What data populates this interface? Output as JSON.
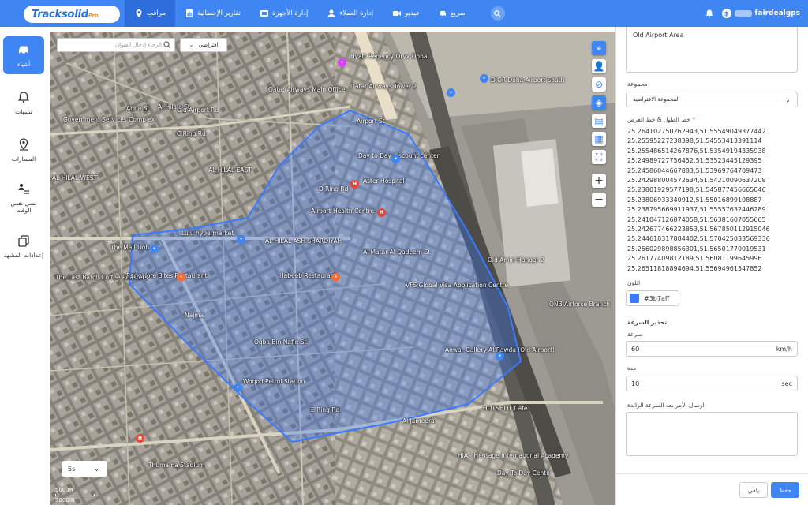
{
  "brand": {
    "logo": "Tracksolid",
    "logo_suffix": "Pro"
  },
  "nav": [
    {
      "label": "مراقب",
      "icon": "location-pin-icon",
      "active": true
    },
    {
      "label": "تقارير الإحصائية",
      "icon": "report-icon",
      "active": false
    },
    {
      "label": "إدارة الأجهزة",
      "icon": "device-icon",
      "active": false
    },
    {
      "label": "إدارة العملاء",
      "icon": "user-icon",
      "active": false
    },
    {
      "label": "فيديو",
      "icon": "video-icon",
      "active": false
    },
    {
      "label": "سريع",
      "icon": "car-icon",
      "active": false
    }
  ],
  "user": {
    "name": "fairdealgps"
  },
  "sidebar": [
    {
      "label": "أشياء",
      "icon": "car-icon",
      "active": true
    },
    {
      "label": "تنبيهات",
      "icon": "alert-icon",
      "active": false
    },
    {
      "label": "المسارات",
      "icon": "route-pin-icon",
      "active": false
    },
    {
      "label": "تسي نفس الوقت",
      "icon": "sync-icon",
      "active": false
    },
    {
      "label": "إعدادات المشهد",
      "icon": "copy-icon",
      "active": false
    }
  ],
  "map": {
    "search_placeholder": "الرجاء إدخال العنوان",
    "layer_select": "افتراضي",
    "interval": "5s",
    "scale_m": "500 m",
    "scale_ft": "3000 ft",
    "fence_color": "#3b7aff",
    "labels": [
      "AL HILAL EAST",
      "AL HILAL ASH SHARQIYAH",
      "AL HILAL WEST",
      "Lulu hypermarket",
      "The Mall Doha",
      "Bangalore Bites Restaurant",
      "Habeeb Restaurant",
      "Aster Hospital",
      "Airport Health Centre",
      "Day to Day discount center",
      "Qatar Airways Tower 2",
      "Qatar Airways Main Office",
      "Hyatt Regency Oryx Doha",
      "DIOR Doha Airport South",
      "Old Airport Rd",
      "Airport St",
      "C Ring Rd",
      "D Ring Rd",
      "E Ring Rd",
      "Government Services Complex",
      "Al Matar Al Qadeem St",
      "VFS Global Visa Application Centre",
      "Anwar Gallery Al Rawda (Old Airport)",
      "Woqod Petrol Station",
      "Oqba Bin Nafie St",
      "Najma",
      "Old Amiri Hangar 2",
      "QNB Airforce Branch",
      "Thumama Stadium",
      "HOTSHOT Café",
      "Al Jameera",
      "HIA - Heritage International Academy",
      "Day To Day Center",
      "The Last Batch Coffee Roasters",
      "Abha St",
      "Al Hilala St"
    ]
  },
  "panel": {
    "area_name": "Old Airport Area",
    "group_label": "مجموعة",
    "group_value": "المجموعة الافتراضية",
    "coords_label": "خط الطول & خط العرض",
    "coords": [
      "25.264102750262943,51.55549049377442",
      "25.25595227238398,51.54553413391114",
      "25.255486514267876,51.53549194335938",
      "25.24989727756452,51.53523445129395",
      "25.24586044667883,51.53969764709473",
      "25.242988004572634,51.54210090637208",
      "25.23801929577198,51.545877456665046",
      "25.23806933340912,51.55016899108887",
      "25.238795669911937,51.55557632446289",
      "25.241047126874058,51.56381607055665",
      "25.242677466223853,51.567850112915046",
      "25.244618317884402,51.570425033569336",
      "25.256029898856301,51.56501770019531",
      "25.26177409812189,51.56081199645996",
      "25.26511818894694,51.55694961547852"
    ],
    "color_label": "اللون",
    "color_value": "#3b7aff",
    "speed_section": "تحذير السرعة",
    "speed_label": "سرعة",
    "speed_value": "60",
    "speed_unit": "km/h",
    "duration_label": "مدة",
    "duration_value": "10",
    "duration_unit": "sec",
    "command_label": "ارسال الأمر بعد السرعة الزائدة",
    "save": "حفظ",
    "cancel": "يلغي"
  }
}
